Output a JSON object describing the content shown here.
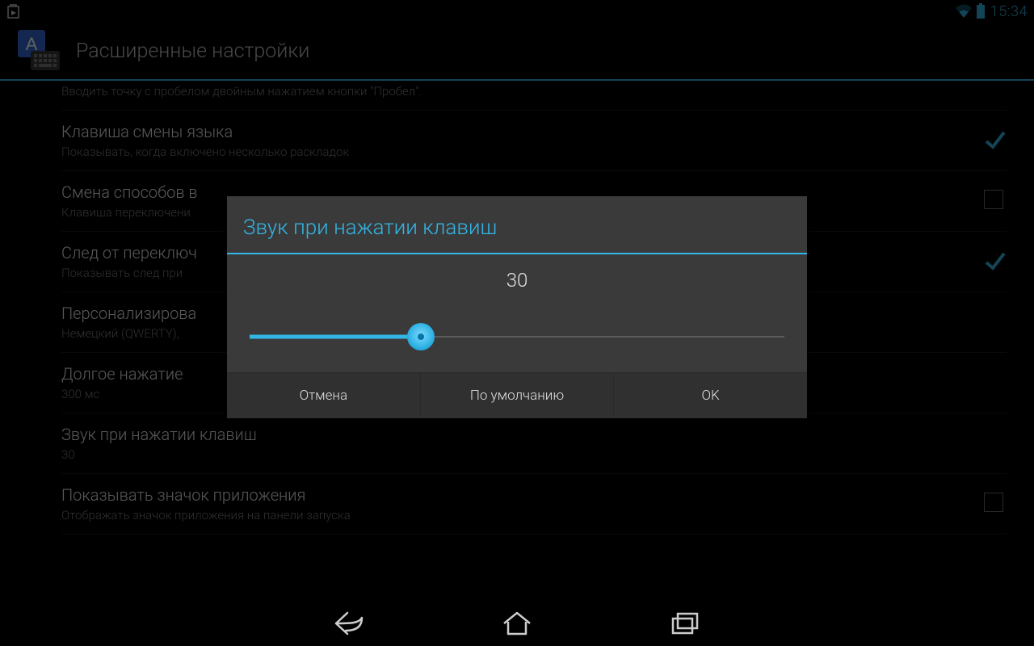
{
  "status": {
    "clock": "15:34"
  },
  "header": {
    "title": "Расширенные настройки"
  },
  "settings": {
    "space_double_sub": "Вводить точку с пробелом двойным нажатием кнопки \"Пробел\".",
    "lang_key_title": "Клавиша смены языка",
    "lang_key_sub": "Показывать, когда включено несколько раскладок",
    "switch_method_title": "Смена способов в",
    "switch_method_sub": "Клавиша переключени",
    "trail_title": "След от переключ",
    "trail_sub": "Показывать след при",
    "personalized_title": "Персонализирова",
    "personalized_sub": "Немецкий (QWERTY),",
    "long_press_title": "Долгое нажатие",
    "long_press_sub": "300 мс",
    "sound_title": "Звук при нажатии клавиш",
    "sound_sub": "30",
    "show_icon_title": "Показывать значок приложения",
    "show_icon_sub": "Отображать значок приложения на панели запуска"
  },
  "dialog": {
    "title": "Звук при нажатии клавиш",
    "value": "30",
    "cancel": "Отмена",
    "default": "По умолчанию",
    "ok": "OK"
  }
}
